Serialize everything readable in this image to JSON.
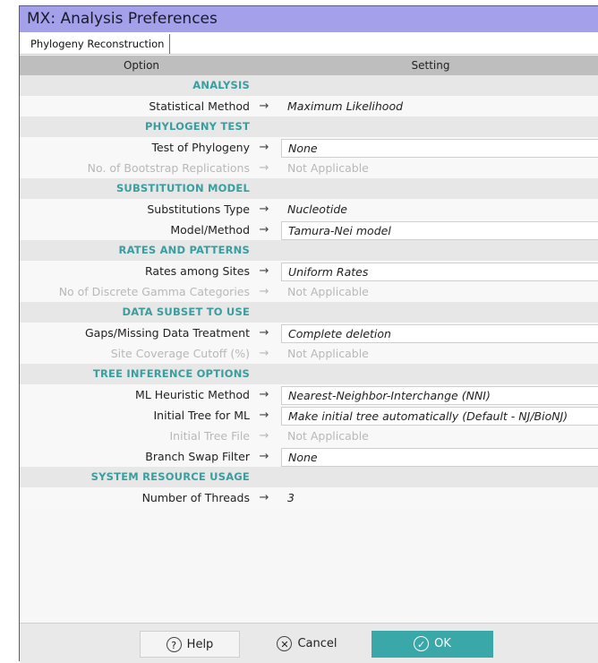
{
  "window": {
    "title": "MX: Analysis Preferences"
  },
  "tabs": [
    {
      "label": "Phylogeny Reconstruction"
    }
  ],
  "columns": {
    "option": "Option",
    "setting": "Setting"
  },
  "rows": [
    {
      "type": "section",
      "label": "ANALYSIS"
    },
    {
      "type": "item",
      "option": "Statistical Method",
      "arrow": "→",
      "value": "Maximum Likelihood",
      "boxed": false,
      "enabled": true
    },
    {
      "type": "section",
      "label": "PHYLOGENY TEST"
    },
    {
      "type": "item",
      "option": "Test of Phylogeny",
      "arrow": "→",
      "value": "None",
      "boxed": true,
      "enabled": true
    },
    {
      "type": "item",
      "option": "No. of Bootstrap Replications",
      "arrow": "→",
      "value": "Not Applicable",
      "boxed": false,
      "enabled": false
    },
    {
      "type": "section",
      "label": "SUBSTITUTION MODEL"
    },
    {
      "type": "item",
      "option": "Substitutions Type",
      "arrow": "→",
      "value": "Nucleotide",
      "boxed": false,
      "enabled": true
    },
    {
      "type": "item",
      "option": "Model/Method",
      "arrow": "→",
      "value": "Tamura-Nei model",
      "boxed": true,
      "enabled": true
    },
    {
      "type": "section",
      "label": "RATES AND PATTERNS"
    },
    {
      "type": "item",
      "option": "Rates among Sites",
      "arrow": "→",
      "value": "Uniform Rates",
      "boxed": true,
      "enabled": true
    },
    {
      "type": "item",
      "option": "No of Discrete Gamma Categories",
      "arrow": "→",
      "value": "Not Applicable",
      "boxed": false,
      "enabled": false
    },
    {
      "type": "section",
      "label": "DATA SUBSET TO USE"
    },
    {
      "type": "item",
      "option": "Gaps/Missing Data Treatment",
      "arrow": "→",
      "value": "Complete deletion",
      "boxed": true,
      "enabled": true
    },
    {
      "type": "item",
      "option": "Site Coverage Cutoff (%)",
      "arrow": "→",
      "value": "Not Applicable",
      "boxed": false,
      "enabled": false
    },
    {
      "type": "section",
      "label": "TREE INFERENCE OPTIONS"
    },
    {
      "type": "item",
      "option": "ML Heuristic Method",
      "arrow": "→",
      "value": "Nearest-Neighbor-Interchange (NNI)",
      "boxed": true,
      "enabled": true
    },
    {
      "type": "item",
      "option": "Initial Tree for ML",
      "arrow": "→",
      "value": "Make initial tree automatically (Default - NJ/BioNJ)",
      "boxed": true,
      "enabled": true
    },
    {
      "type": "item",
      "option": "Initial Tree File",
      "arrow": "→",
      "value": "Not Applicable",
      "boxed": false,
      "enabled": false
    },
    {
      "type": "item",
      "option": "Branch Swap Filter",
      "arrow": "→",
      "value": "None",
      "boxed": true,
      "enabled": true
    },
    {
      "type": "section",
      "label": "SYSTEM RESOURCE USAGE"
    },
    {
      "type": "item",
      "option": "Number of Threads",
      "arrow": "→",
      "value": "3",
      "boxed": false,
      "enabled": true
    }
  ],
  "buttons": {
    "help": {
      "label": "Help",
      "icon": "question-icon",
      "glyph": "?"
    },
    "cancel": {
      "label": "Cancel",
      "icon": "close-icon",
      "glyph": "✕"
    },
    "ok": {
      "label": "OK",
      "icon": "check-icon",
      "glyph": "✓",
      "color": "#3aa8a8"
    }
  }
}
